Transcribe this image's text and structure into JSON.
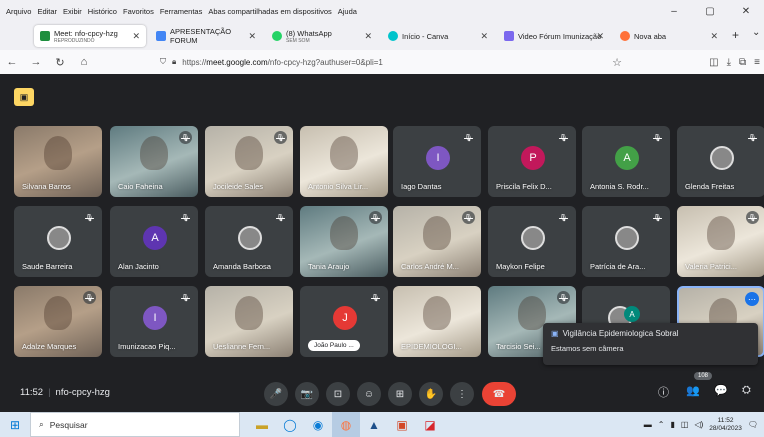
{
  "menubar": {
    "items": [
      "Arquivo",
      "Editar",
      "Exibir",
      "Histórico",
      "Favoritos",
      "Ferramentas",
      "Abas compartilhadas em dispositivos",
      "Ajuda"
    ]
  },
  "window_controls": {
    "minimize": "–",
    "maximize": "▢",
    "close": "✕"
  },
  "tabs": [
    {
      "title": "Meet: nfo-cpcy-hzg",
      "subtitle": "REPRODUZINDO",
      "close": "✕",
      "color": "#1e8e3e"
    },
    {
      "title": "APRESENTAÇÃO FORUM",
      "subtitle": "",
      "close": "✕",
      "color": "#4285f4"
    },
    {
      "title": "(8) WhatsApp",
      "subtitle": "SEM SOM",
      "close": "✕",
      "color": "#25d366"
    },
    {
      "title": "Início - Canva",
      "subtitle": "",
      "close": "✕",
      "color": "#00c4cc"
    },
    {
      "title": "Video Fórum Imunização",
      "subtitle": "",
      "close": "✕",
      "color": "#7b68ee"
    },
    {
      "title": "Nova aba",
      "subtitle": "",
      "close": "✕",
      "color": "#ff7139"
    }
  ],
  "tabbar": {
    "new_tab": "+",
    "list_tabs": "⌄"
  },
  "nav": {
    "back": "←",
    "forward": "→",
    "reload": "↻",
    "home": "⌂",
    "url_prefix": "https://",
    "url_domain": "meet.google.com",
    "url_path": "/nfo-cpcy-hzg?authuser=0&pli=1",
    "bookmark": "☆"
  },
  "nav_right": {
    "pocket": "◫",
    "downloads": "⤓",
    "extensions": "⧉",
    "menu": "≡"
  },
  "meet": {
    "side_button": "▣",
    "tiles": [
      {
        "name": "Silvana Barros",
        "type": "video",
        "style": "v1",
        "muted": false
      },
      {
        "name": "Caio Faheina",
        "type": "video",
        "style": "v3",
        "muted": true
      },
      {
        "name": "Jocileide Sales",
        "type": "video",
        "style": "v2",
        "muted": true
      },
      {
        "name": "Antonio Silva Lir...",
        "type": "video",
        "style": "v4",
        "muted": false
      },
      {
        "name": "Iago Dantas",
        "type": "initial",
        "initial": "I",
        "color": "#7e57c2",
        "muted": true
      },
      {
        "name": "Priscila Felix D...",
        "type": "initial",
        "initial": "P",
        "color": "#c2185b",
        "muted": true
      },
      {
        "name": "Antonia S. Rodr...",
        "type": "initial",
        "initial": "A",
        "color": "#43a047",
        "muted": true
      },
      {
        "name": "Glenda Freitas",
        "type": "photo",
        "muted": true
      },
      {
        "name": "Saude Barreira",
        "type": "photo",
        "muted": true
      },
      {
        "name": "Alan Jacinto",
        "type": "initial",
        "initial": "A",
        "color": "#5e35b1",
        "muted": true
      },
      {
        "name": "Amanda Barbosa",
        "type": "photo",
        "muted": true
      },
      {
        "name": "Tania Araujo",
        "type": "video",
        "style": "v3",
        "muted": true
      },
      {
        "name": "Carlos André M...",
        "type": "video",
        "style": "v2",
        "muted": true
      },
      {
        "name": "Maykon Felipe",
        "type": "photo",
        "muted": true
      },
      {
        "name": "Patrícia de Ara...",
        "type": "photo",
        "muted": true
      },
      {
        "name": "Valeria Patrici...",
        "type": "video",
        "style": "v4",
        "muted": true
      },
      {
        "name": "Adalze Marques",
        "type": "video",
        "style": "v1",
        "muted": true
      },
      {
        "name": "Imunizacao Piq...",
        "type": "initial",
        "initial": "I",
        "color": "#7e57c2",
        "muted": true
      },
      {
        "name": "Ueslianne Fern...",
        "type": "video",
        "style": "v2",
        "muted": false
      },
      {
        "name": "João Paulo ...",
        "type": "initial-pill",
        "initial": "J",
        "color": "#e53935",
        "muted": true
      },
      {
        "name": "EPIDEMIOLOGI...",
        "type": "video",
        "style": "v4",
        "muted": false
      },
      {
        "name": "Tarcisio Sei...",
        "type": "video",
        "style": "v3",
        "muted": true
      },
      {
        "name": "",
        "type": "photo-a",
        "muted": false
      },
      {
        "name": "",
        "type": "video-selected",
        "style": "v2",
        "muted": false
      }
    ],
    "tooltip": {
      "title": "Vigilância Epidemiologica Sobral",
      "subtitle": "Estamos sem câmera"
    }
  },
  "bottombar": {
    "time": "11:52",
    "meeting_code": "nfo-cpcy-hzg",
    "mic": "🎤",
    "camera": "📷",
    "captions": "⊡",
    "emoji": "☺",
    "present": "⊞",
    "hand": "✋",
    "more": "⋮",
    "end": "☎",
    "info": "ⓘ",
    "people": "👥",
    "chat": "💬",
    "activities": "⛭",
    "participant_count": "108"
  },
  "taskbar": {
    "start": "⊞",
    "search_icon": "⌕",
    "search_placeholder": "Pesquisar",
    "time": "11:52",
    "date": "28/04/2023",
    "notifications": "🗨"
  }
}
